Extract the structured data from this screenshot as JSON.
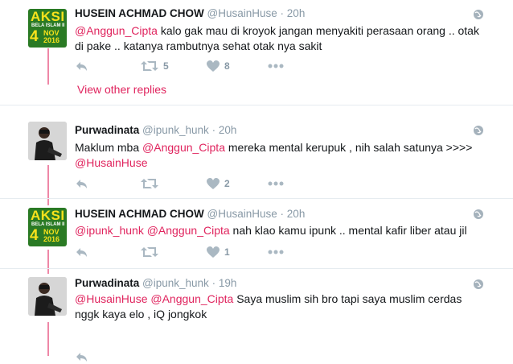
{
  "tweets": [
    {
      "name": "HUSEIN ACHMAD CHOW",
      "handle": "@HusainHuse",
      "sep": "·",
      "time": "20h",
      "avatar": {
        "title": "AKSI",
        "subtitle": "BELA ISLAM II",
        "day": "4",
        "month": "NOV",
        "year": "2016"
      },
      "text_parts": [
        {
          "type": "mention",
          "text": "@Anggun_Cipta"
        },
        {
          "type": "plain",
          "text": " kalo gak mau di kroyok jangan menyakiti perasaan orang .. otak di pake .. katanya rambutnya sehat otak nya sakit"
        }
      ],
      "retweets": "5",
      "likes": "8"
    },
    {
      "name": "Purwadinata",
      "handle": "@ipunk_hunk",
      "sep": "·",
      "time": "20h",
      "text_parts": [
        {
          "type": "plain",
          "text": "Maklum mba "
        },
        {
          "type": "mention",
          "text": "@Anggun_Cipta"
        },
        {
          "type": "plain",
          "text": " mereka mental kerupuk , nih salah satunya >>>> "
        },
        {
          "type": "mention",
          "text": "@HusainHuse"
        }
      ],
      "retweets": "",
      "likes": "2"
    },
    {
      "name": "HUSEIN ACHMAD CHOW",
      "handle": "@HusainHuse",
      "sep": "·",
      "time": "20h",
      "avatar": {
        "title": "AKSI",
        "subtitle": "BELA ISLAM II",
        "day": "4",
        "month": "NOV",
        "year": "2016"
      },
      "text_parts": [
        {
          "type": "mention",
          "text": "@ipunk_hunk"
        },
        {
          "type": "plain",
          "text": " "
        },
        {
          "type": "mention",
          "text": "@Anggun_Cipta"
        },
        {
          "type": "plain",
          "text": " nah klao kamu ipunk .. mental kafir liber atau jil"
        }
      ],
      "retweets": "",
      "likes": "1"
    },
    {
      "name": "Purwadinata",
      "handle": "@ipunk_hunk",
      "sep": "·",
      "time": "19h",
      "text_parts": [
        {
          "type": "mention",
          "text": "@HusainHuse"
        },
        {
          "type": "plain",
          "text": " "
        },
        {
          "type": "mention",
          "text": "@Anggun_Cipta"
        },
        {
          "type": "plain",
          "text": " Saya muslim sih bro tapi saya muslim cerdas nggk kaya elo , iQ jongkok"
        }
      ],
      "retweets": "",
      "likes": ""
    }
  ],
  "view_other_replies": "View other replies",
  "colors": {
    "accent": "#e0245e",
    "muted": "#8899a6",
    "text": "#14171a",
    "border": "#e6ecf0"
  },
  "icons": [
    "reply-icon",
    "retweet-icon",
    "like-icon",
    "more-icon",
    "globe-icon"
  ]
}
